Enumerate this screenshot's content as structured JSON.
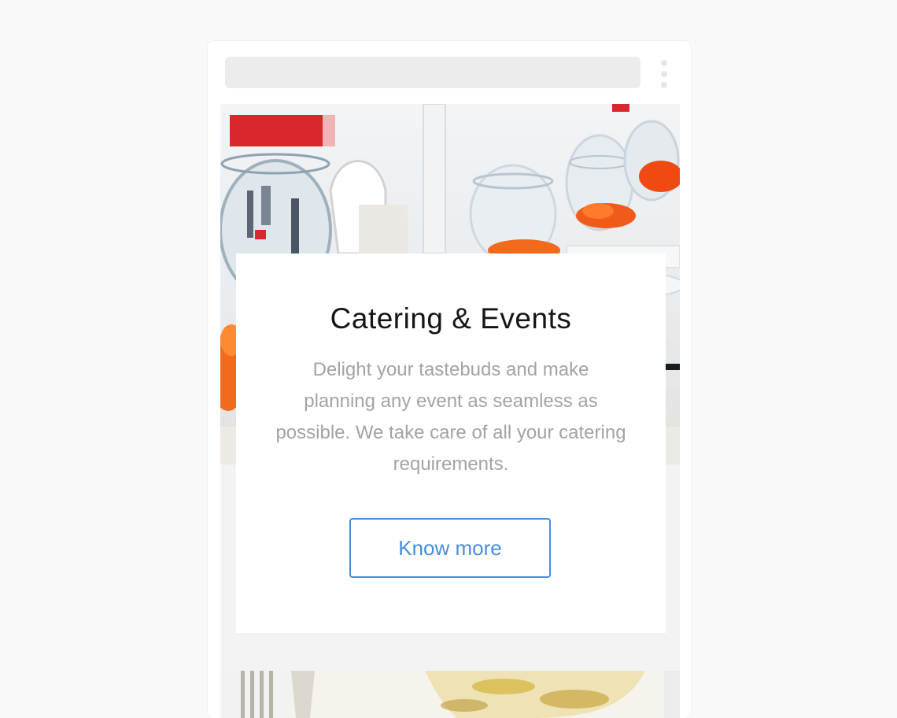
{
  "card": {
    "title": "Catering & Events",
    "description": "Delight your tastebuds and make planning any event as seamless as possible. We take care of all your catering requirements.",
    "button_label": "Know more"
  },
  "colors": {
    "page_background": "#f9f9f9",
    "device_background": "#ffffff",
    "address_bar": "#ececec",
    "accent": "#4a8cdb",
    "title_text": "#151515",
    "body_text": "#a3a3a3"
  },
  "icons": {
    "browser_menu": "kebab-menu-icon"
  }
}
